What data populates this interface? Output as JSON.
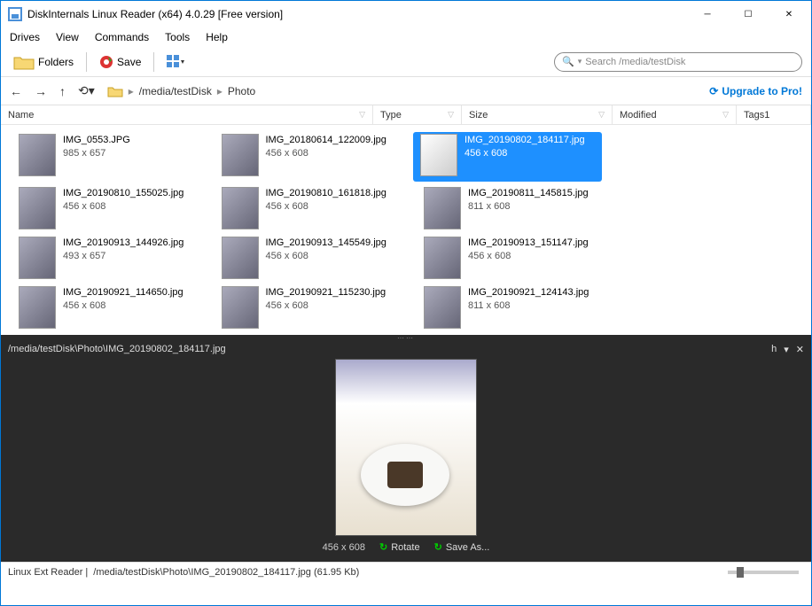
{
  "window": {
    "title": "DiskInternals Linux Reader (x64) 4.0.29 [Free version]"
  },
  "menu": [
    "Drives",
    "View",
    "Commands",
    "Tools",
    "Help"
  ],
  "toolbar": {
    "folders_label": "Folders",
    "save_label": "Save",
    "search_placeholder": "Search /media/testDisk"
  },
  "breadcrumb": {
    "part1": "/media/testDisk",
    "part2": "Photo"
  },
  "upgrade_label": "Upgrade to Pro!",
  "columns": {
    "name": "Name",
    "type": "Type",
    "size": "Size",
    "modified": "Modified",
    "tags1": "Tags1"
  },
  "files": [
    {
      "name": "IMG_0553.JPG",
      "dim": "985 x 657",
      "selected": false
    },
    {
      "name": "IMG_20180614_122009.jpg",
      "dim": "456 x 608",
      "selected": false
    },
    {
      "name": "IMG_20190802_184117.jpg",
      "dim": "456 x 608",
      "selected": true
    },
    {
      "name": "",
      "dim": "",
      "selected": false
    },
    {
      "name": "IMG_20190810_155025.jpg",
      "dim": "456 x 608",
      "selected": false
    },
    {
      "name": "IMG_20190810_161818.jpg",
      "dim": "456 x 608",
      "selected": false
    },
    {
      "name": "IMG_20190811_145815.jpg",
      "dim": "811 x 608",
      "selected": false
    },
    {
      "name": "",
      "dim": "",
      "selected": false
    },
    {
      "name": "IMG_20190913_144926.jpg",
      "dim": "493 x 657",
      "selected": false
    },
    {
      "name": "IMG_20190913_145549.jpg",
      "dim": "456 x 608",
      "selected": false
    },
    {
      "name": "IMG_20190913_151147.jpg",
      "dim": "456 x 608",
      "selected": false
    },
    {
      "name": "",
      "dim": "",
      "selected": false
    },
    {
      "name": "IMG_20190921_114650.jpg",
      "dim": "456 x 608",
      "selected": false
    },
    {
      "name": "IMG_20190921_115230.jpg",
      "dim": "456 x 608",
      "selected": false
    },
    {
      "name": "IMG_20190921_124143.jpg",
      "dim": "811 x 608",
      "selected": false
    }
  ],
  "preview": {
    "path": "/media/testDisk\\Photo\\IMG_20190802_184117.jpg",
    "dim": "456 x 608",
    "rotate_label": "Rotate",
    "saveas_label": "Save As...",
    "pin": "h"
  },
  "status": {
    "reader": "Linux Ext Reader |",
    "path": "/media/testDisk\\Photo\\IMG_20190802_184117.jpg (61.95 Kb)"
  }
}
